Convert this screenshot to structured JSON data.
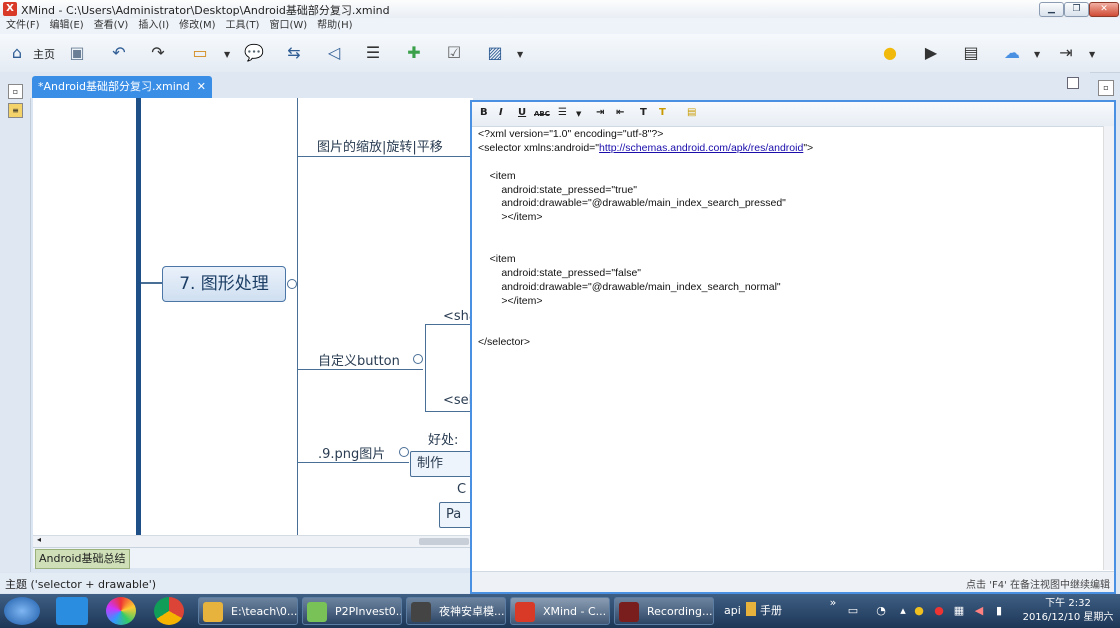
{
  "window": {
    "title": "XMind - C:\\Users\\Administrator\\Desktop\\Android基础部分复习.xmind"
  },
  "menu": [
    "文件(F)",
    "编辑(E)",
    "查看(V)",
    "插入(I)",
    "修改(M)",
    "工具(T)",
    "窗口(W)",
    "帮助(H)"
  ],
  "toolbar": {
    "home_label": "主页"
  },
  "tab": {
    "label": "*Android基础部分复习.xmind",
    "close": "✕"
  },
  "mindmap": {
    "central": "7. 图形处理",
    "topics": {
      "scale": "图片的缩放|旋转|平移",
      "custom_button": "自定义button",
      "ninepatch": ".9.png图片"
    },
    "subtopics": {
      "shape": "<sha",
      "selector": "<sel",
      "benefit": "好处:",
      "make": "制作",
      "c": "C",
      "p": "Pa"
    }
  },
  "sheet": {
    "label": "Android基础总结"
  },
  "status": {
    "text": "主题 ('selector + drawable')"
  },
  "notes": {
    "toolbar": [
      "B",
      "I",
      "U",
      "ABC"
    ],
    "lines": [
      "<?xml version=\"1.0\" encoding=\"utf-8\"?>",
      "<selector xmlns:android=\"",
      "",
      "    <item",
      "        android:state_pressed=\"true\"",
      "        android:drawable=\"@drawable/main_index_search_pressed\"",
      "        ></item>",
      "",
      "",
      "    <item",
      "        android:state_pressed=\"false\"",
      "        android:drawable=\"@drawable/main_index_search_normal\"",
      "        ></item>",
      "",
      "",
      "</selector>"
    ],
    "link": "http://schemas.android.com/apk/res/android",
    "link_after": "\">",
    "status_hint": "点击 'F4' 在备注视图中继续编辑"
  },
  "taskbar": {
    "items": [
      "E:\\teach\\0...",
      "P2PInvest0...",
      "夜神安卓模...",
      "XMind - C...",
      "Recording..."
    ],
    "api_label": "api",
    "manual_label": "手册",
    "clock_time": "下午 2:32",
    "clock_date": "2016/12/10 星期六"
  }
}
